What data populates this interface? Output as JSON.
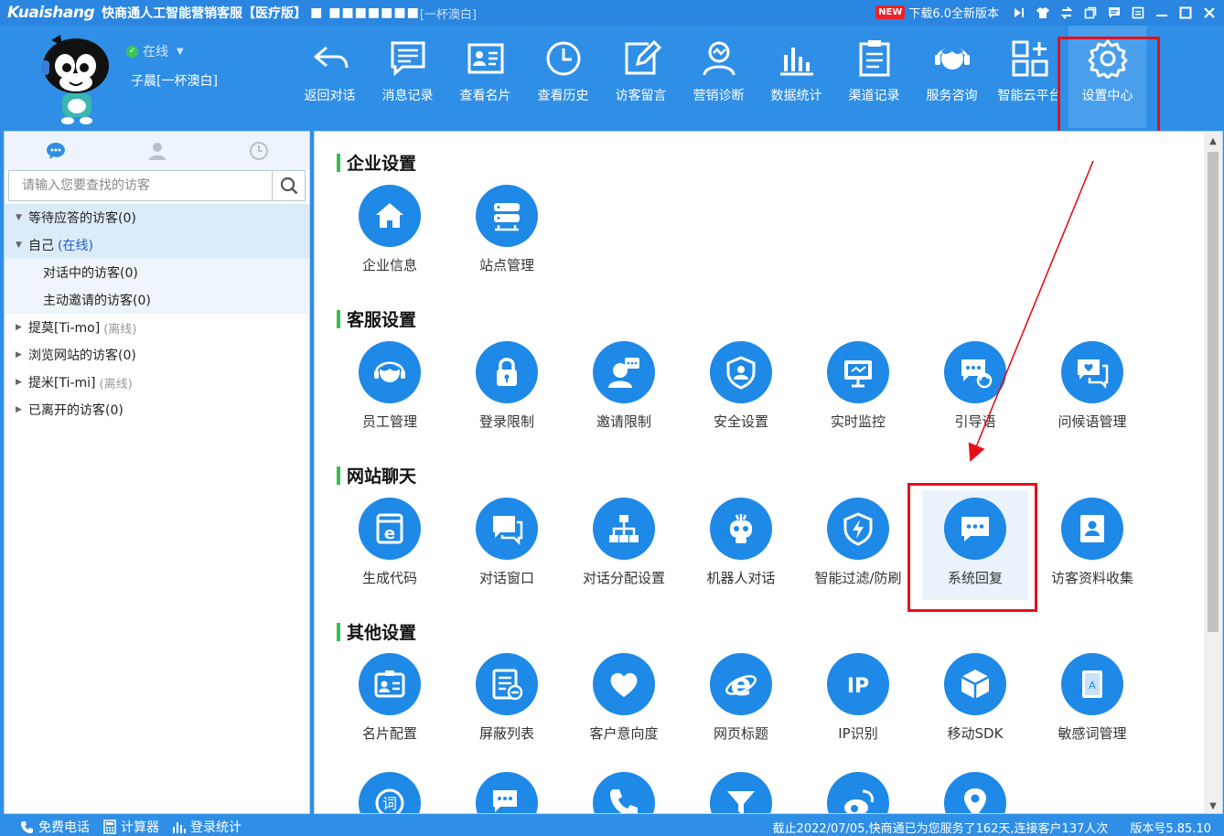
{
  "titlebar": {
    "brand": "Kuaishang",
    "app_title": "快商通人工智能营销客服【医疗版】",
    "masked": "■ ■■■■■■■",
    "suffix": "[一杯澳白]",
    "new_badge": "NEW",
    "download_text": "下载6.0全新版本"
  },
  "user": {
    "status": "在线",
    "name": "子晨[一杯澳白]"
  },
  "toolbar": {
    "items": [
      {
        "label": "返回对话",
        "icon": "return-arrow-icon"
      },
      {
        "label": "消息记录",
        "icon": "message-icon"
      },
      {
        "label": "查看名片",
        "icon": "card-icon"
      },
      {
        "label": "查看历史",
        "icon": "clock-icon"
      },
      {
        "label": "访客留言",
        "icon": "edit-icon"
      },
      {
        "label": "营销诊断",
        "icon": "diagnosis-icon"
      },
      {
        "label": "数据统计",
        "icon": "bar-chart-icon"
      },
      {
        "label": "渠道记录",
        "icon": "clipboard-icon"
      },
      {
        "label": "服务咨询",
        "icon": "headset-icon"
      },
      {
        "label": "智能云平台",
        "icon": "grid-plus-icon"
      },
      {
        "label": "设置中心",
        "icon": "gear-icon"
      }
    ]
  },
  "left": {
    "search_placeholder": "请输入您要查找的访客",
    "tree": [
      {
        "label": "等待应答的访客(0)",
        "type": "group",
        "arrow": "▼"
      },
      {
        "label": "自己",
        "extra": "(在线)",
        "extra_class": "online",
        "type": "group",
        "arrow": "▼"
      },
      {
        "label": "对话中的访客(0)",
        "type": "sub"
      },
      {
        "label": "主动邀请的访客(0)",
        "type": "sub"
      },
      {
        "label": "提莫[Ti-mo]",
        "extra": "(离线)",
        "extra_class": "offline",
        "type": "plain",
        "arrow": "▶"
      },
      {
        "label": "浏览网站的访客(0)",
        "type": "plain",
        "arrow": "▶"
      },
      {
        "label": "提米[Ti-mi]",
        "extra": "(离线)",
        "extra_class": "offline",
        "type": "plain",
        "arrow": "▶"
      },
      {
        "label": "已离开的访客(0)",
        "type": "plain",
        "arrow": "▶"
      }
    ]
  },
  "sections": [
    {
      "title": "企业设置",
      "items": [
        {
          "label": "企业信息",
          "icon": "home-icon"
        },
        {
          "label": "站点管理",
          "icon": "server-icon"
        }
      ]
    },
    {
      "title": "客服设置",
      "items": [
        {
          "label": "员工管理",
          "icon": "headset-person-icon"
        },
        {
          "label": "登录限制",
          "icon": "lock-icon"
        },
        {
          "label": "邀请限制",
          "icon": "person-chat-icon"
        },
        {
          "label": "安全设置",
          "icon": "shield-person-icon"
        },
        {
          "label": "实时监控",
          "icon": "monitor-icon"
        },
        {
          "label": "引导语",
          "icon": "chat-refresh-icon"
        },
        {
          "label": "问候语管理",
          "icon": "chat-heart-icon"
        }
      ]
    },
    {
      "title": "网站聊天",
      "items": [
        {
          "label": "生成代码",
          "icon": "code-window-icon"
        },
        {
          "label": "对话窗口",
          "icon": "chat-bubbles-icon"
        },
        {
          "label": "对话分配设置",
          "icon": "hierarchy-icon"
        },
        {
          "label": "机器人对话",
          "icon": "robot-icon"
        },
        {
          "label": "智能过滤/防刷",
          "icon": "shield-bolt-icon"
        },
        {
          "label": "系统回复",
          "icon": "chat-dots-icon"
        },
        {
          "label": "访客资料收集",
          "icon": "contact-card-icon"
        }
      ]
    },
    {
      "title": "其他设置",
      "items": [
        {
          "label": "名片配置",
          "icon": "id-card-icon"
        },
        {
          "label": "屏蔽列表",
          "icon": "list-block-icon"
        },
        {
          "label": "客户意向度",
          "icon": "heart-icon"
        },
        {
          "label": "网页标题",
          "icon": "browser-e-icon"
        },
        {
          "label": "IP识别",
          "icon": "ip-icon"
        },
        {
          "label": "移动SDK",
          "icon": "cube-icon"
        },
        {
          "label": "敏感词管理",
          "icon": "book-icon"
        }
      ]
    },
    {
      "title": "",
      "items": [
        {
          "label": "",
          "icon": "word-icon"
        },
        {
          "label": "",
          "icon": "chat-edit-icon"
        },
        {
          "label": "",
          "icon": "phone-icon"
        },
        {
          "label": "",
          "icon": "filter-icon"
        },
        {
          "label": "",
          "icon": "weibo-icon"
        },
        {
          "label": "",
          "icon": "location-icon"
        }
      ]
    }
  ],
  "statusbar": {
    "left": [
      {
        "label": "免费电话",
        "icon": "phone-small-icon"
      },
      {
        "label": "计算器",
        "icon": "calculator-icon"
      },
      {
        "label": "登录统计",
        "icon": "stats-icon"
      }
    ],
    "service_text": "截止2022/07/05,快商通已为您服务了162天,连接客户137人次",
    "version": "版本号5.85.10"
  },
  "colors": {
    "primary": "#2f8fe6",
    "icon_blue": "#1e89e6",
    "highlight": "#e3101a",
    "section_bar": "#35c14a"
  }
}
